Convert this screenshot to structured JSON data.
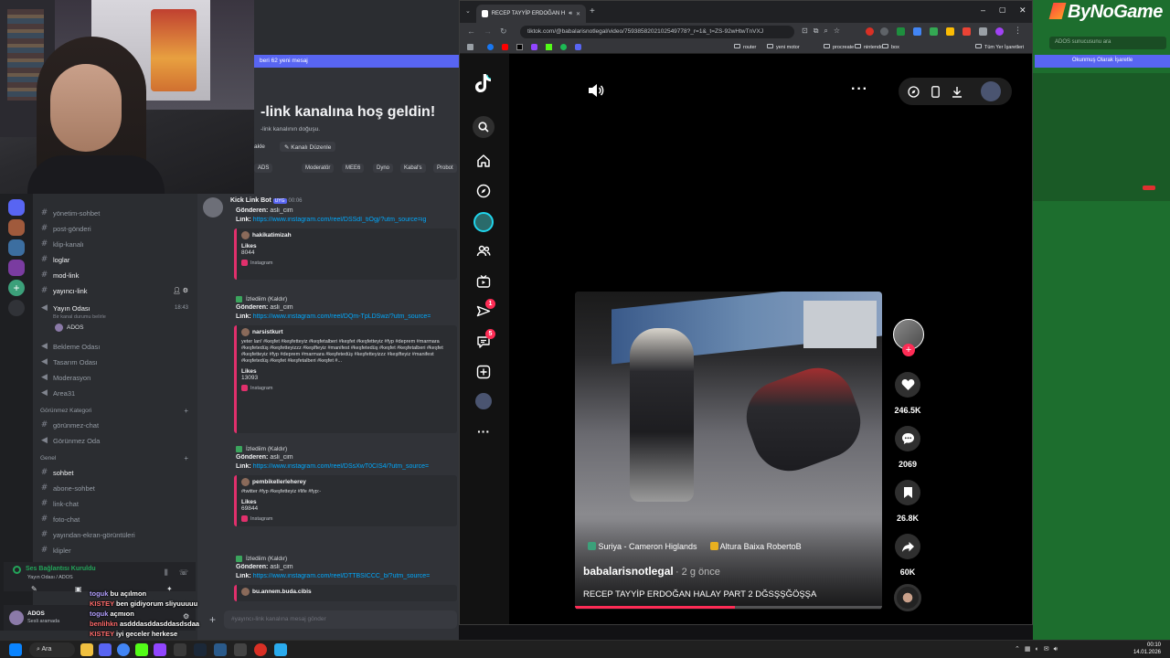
{
  "browser": {
    "tab_title": "RECEP TAYYİP ERDOĞAN H",
    "url": "tiktok.com/@babalarisnotlegal/video/7593858202102549778?_r=1&_t=ZS-92wHtwTnVXJ",
    "bookmarks": [
      "router",
      "yeni motor",
      "procreate",
      "nintendo",
      "box",
      "Tüm Yer İşaretleri"
    ]
  },
  "tiktok": {
    "sidebar_badges": {
      "inbox": "1",
      "messages": "5"
    },
    "video": {
      "username": "babalarisnotlegal",
      "posted": "· 2 g önce",
      "caption": "RECEP TAYYİP ERDOĞAN HALAY PART 2 DĞSŞŞĞÖŞŞA",
      "anchor_left": "Suriya - Cameron Higlands",
      "anchor_right": "Altura Baixa RobertoB",
      "progress": 0.52
    },
    "counts": {
      "likes": "246.5K",
      "comments": "2069",
      "saves": "26.8K",
      "shares": "60K"
    }
  },
  "discord": {
    "new_messages_bar": "beri 62 yeni mesaj",
    "welcome_title": "-link kanalına hoş geldin!",
    "welcome_sub": "-link kanalının doğuşu.",
    "edit_channel": "Kanalı Düzenle",
    "edit_channel_prefix": "akle",
    "tags": [
      "ADS",
      "Moderatör",
      "MEE6",
      "Dyno",
      "Kabal's",
      "Probot"
    ],
    "bot_name": "Kick Link Bot",
    "bot_badge": "UYG",
    "bot_time": "00:06",
    "channels": [
      {
        "name": "yönetim-sohbet",
        "type": "text"
      },
      {
        "name": "post-gönderi",
        "type": "text"
      },
      {
        "name": "klip-kanalı",
        "type": "text"
      },
      {
        "name": "loglar",
        "type": "text"
      },
      {
        "name": "mod-link",
        "type": "text"
      },
      {
        "name": "yayıncı-link",
        "type": "text"
      }
    ],
    "voice_active": {
      "name": "Yayın Odası",
      "time": "18:43",
      "sub": "Bir kanal durumu belirle",
      "member": "ADOS"
    },
    "voice_channels": [
      "Bekleme Odası",
      "Tasarım Odası",
      "Moderasyon",
      "Area31"
    ],
    "category_hidden": "Görünmez Kategori",
    "hidden_channels": [
      {
        "name": "görünmez-chat",
        "type": "text"
      },
      {
        "name": "Görünmez Oda",
        "type": "voice"
      }
    ],
    "category_general": "Genel",
    "general_channels": [
      "sohbet",
      "abone-sohbet",
      "link-chat",
      "foto-chat",
      "yayından-ekran-görüntüleri",
      "klipler"
    ],
    "messages": [
      {
        "sender_label": "Gönderen:",
        "sender": "asli_cim",
        "link_label": "Link:",
        "link": "https://www.instagram.com/reel/DSSdI_tiOgj/?utm_source=ig",
        "embed_author": "hakikatimizah",
        "embed_desc": "",
        "likes_label": "Likes",
        "likes": "8044",
        "footer": "Instagram"
      },
      {
        "sender_label": "Gönderen:",
        "sender": "asli_cim",
        "link_label": "Link:",
        "link": "https://www.instagram.com/reel/DQm-TpLDSwz/?utm_source=",
        "embed_author": "narsistkurt",
        "embed_desc": "yeter lan! #keşfet #keşfetteyiz #keşfetalberi #keşfet #keşfetteyiz #fyp #deprem #marmara #keşfetedüş #keşfetteyizzz #keşifteyiz #manifest #keşfetedüş #keşfet #keşfetalberi #keşfet #keşfetteyiz #fyp #deprem #marmara #keşfetedüş #keşfetteyizzz #keşifteyiz #manifest #keşfetedüş #keşfet #keşfetalberi #keşfet #...",
        "likes_label": "Likes",
        "likes": "13093",
        "footer": "Instagram"
      },
      {
        "sender_label": "Gönderen:",
        "sender": "asli_cim",
        "link_label": "Link:",
        "link": "https://www.instagram.com/reel/DSsXwT0CIS4/?utm_source=",
        "embed_author": "pembikellerleherey",
        "embed_desc": "#twitter #fyp #keşfetteyiz #life #fyp:-",
        "likes_label": "Likes",
        "likes": "69844",
        "footer": "Instagram"
      },
      {
        "sender_label": "Gönderen:",
        "sender": "asli_cim",
        "link_label": "Link:",
        "link": "https://www.instagram.com/reel/DTTBSICCC_b/?utm_source=",
        "embed_author": "bu.annem.buda.cibis",
        "embed_desc": "",
        "likes_label": "",
        "likes": "",
        "footer": ""
      }
    ],
    "watched_label": "İzlediim (Kaldır)",
    "input_placeholder": "#yayıncı-link kanalına mesaj gönder",
    "voice_status": "Ses Bağlantısı Kuruldu",
    "voice_status_sub": "Yayın Odası / ADOS",
    "user": {
      "name": "ADOS",
      "status": "Sesli aramada"
    }
  },
  "stream_chat": [
    {
      "user": "toguk",
      "msg": "bu açılmon",
      "color": "#b3a0ff"
    },
    {
      "user": "KISTEY",
      "msg": "ben gidiyorum sliyuuuuu",
      "color": "#ff6b6b"
    },
    {
      "user": "toguk",
      "msg": "açmıon",
      "color": "#b3a0ff"
    },
    {
      "user": "benlihkn",
      "msg": "asdddasddasddasdsdaa",
      "color": "#ff6b6b"
    },
    {
      "user": "KISTEY",
      "msg": "iyi geceler herkese",
      "color": "#ff6b6b"
    }
  ],
  "right_panel": {
    "logo": "ByNoGame",
    "search": "ADOS sunucusunu ara",
    "mark_read": "Okunmuş Olarak İşaretle"
  },
  "taskbar": {
    "search": "Ara",
    "time": "00:10",
    "date": "14.01.2026"
  },
  "colors": {
    "tiktok_red": "#fe2c55",
    "discord_blurple": "#5865f2",
    "instagram": "#e1306c"
  }
}
